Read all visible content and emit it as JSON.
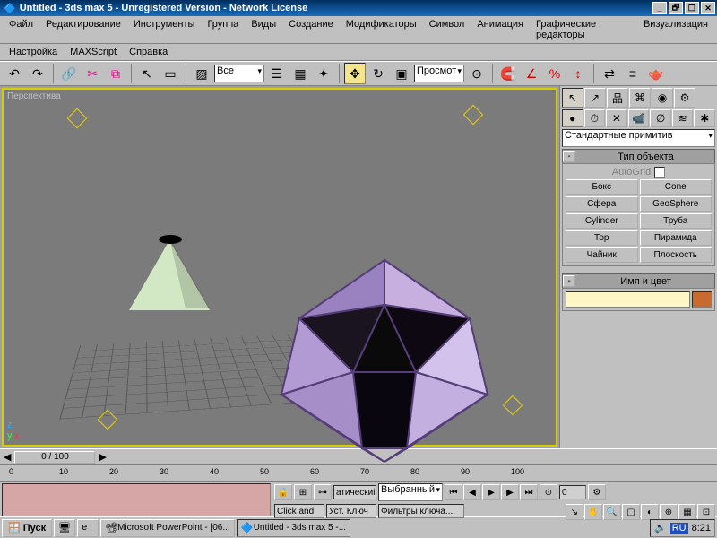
{
  "title": "Untitled - 3ds max 5 - Unregistered Version - Network License",
  "win_controls": {
    "min": "_",
    "max": "❐",
    "restore": "🗗",
    "close": "✕"
  },
  "menu1": [
    "Файл",
    "Редактирование",
    "Инструменты",
    "Группа",
    "Виды",
    "Создание",
    "Модификаторы",
    "Символ",
    "Анимация",
    "Графические редакторы",
    "Визуализация"
  ],
  "menu2": [
    "Настройка",
    "MAXScript",
    "Справка"
  ],
  "toolbar": {
    "undo": "↶",
    "redo": "↷",
    "link": "🔗",
    "unlink": "✂",
    "bind": "⧉",
    "select": "↖",
    "region": "▭",
    "filter_label": "Все",
    "byname": "☰",
    "color": "▦",
    "move": "✥",
    "rotate": "↻",
    "scale": "▣",
    "coord_label": "Просмот",
    "center": "⊙",
    "snap": "S",
    "angle": "∠",
    "percent": "%",
    "spinner": "↕",
    "mirror": "⇄",
    "align": "≡",
    "render": "🫖"
  },
  "viewport": {
    "label": "Перспектива",
    "axes": {
      "x": "x",
      "y": "y",
      "z": "z"
    }
  },
  "cmd": {
    "tabs": [
      "↖",
      "↗",
      "品",
      "⌘",
      "◉",
      "⚙"
    ],
    "subtabs": [
      "●",
      "⏱",
      "✕",
      "📹",
      "∅",
      "≋",
      "✱"
    ],
    "dropdown": "Стандартные примитив",
    "section_type": "Тип объекта",
    "autogrid": "AutoGrid",
    "objects": [
      [
        "Бокс",
        "Cone"
      ],
      [
        "Сфера",
        "GeoSphere"
      ],
      [
        "Cylinder",
        "Труба"
      ],
      [
        "Тор",
        "Пирамида"
      ],
      [
        "Чайник",
        "Плоскость"
      ]
    ],
    "section_name": "Имя и цвет"
  },
  "timeline": {
    "pos": "0 / 100",
    "ticks": [
      0,
      10,
      20,
      30,
      40,
      50,
      60,
      70,
      80,
      90,
      100
    ]
  },
  "bottom": {
    "btn_lock": "🔒",
    "btn_snap": "⊞",
    "btn_key": "⊶",
    "label1": "атическиі",
    "select1": "Выбранный",
    "label2": "Уст. Ключ",
    "label3": "Фильтры ключа...",
    "label4": "Click and",
    "play": {
      "first": "⏮",
      "prev": "◀",
      "play": "▶",
      "next": "▶",
      "last": "⏭",
      "keymode": "⊙",
      "time": "0",
      "cfg": "⚙"
    },
    "nav": [
      "↘",
      "✋",
      "🔍",
      "▢",
      "◐",
      "⊕",
      "▦",
      "⊡"
    ]
  },
  "taskbar": {
    "start": "Пуск",
    "items": [
      {
        "icon": "🖥",
        "label": ""
      },
      {
        "icon": "e",
        "label": ""
      },
      {
        "icon": "📽",
        "label": "Microsoft PowerPoint - [06..."
      },
      {
        "icon": "🔷",
        "label": "Untitled - 3ds max 5 -...",
        "active": true
      }
    ],
    "tray": {
      "lang": "RU",
      "time": "8:21"
    }
  }
}
